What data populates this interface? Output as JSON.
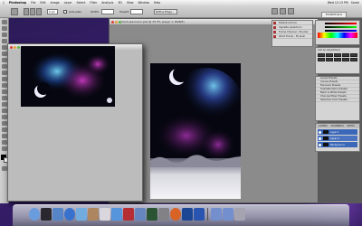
{
  "menubar": {
    "app": "Photoshop",
    "items": [
      "File",
      "Edit",
      "Image",
      "Layer",
      "Select",
      "Filter",
      "Analysis",
      "3D",
      "View",
      "Window",
      "Help"
    ],
    "right": [
      "Wed 12:13 PM",
      "Sarah"
    ]
  },
  "options": {
    "field_value": "0 px",
    "label_antialias": "Anti-alias",
    "label_width": "Width:",
    "label_height": "Height:",
    "refine": "Refine Edge...",
    "workspace": "ESSENTIALS"
  },
  "doc_main": {
    "title": "cloud-sea-moon.psd @ 33.3% (Layer 1, RGB/8)"
  },
  "doc_source": {
    "title": "space-nebula.jpg @ 33% (RGB/8)"
  },
  "nav_panel": {
    "rows": [
      "Default Actions",
      "Vignette (selection)",
      "Frame Channel - 50 pixel",
      "Wood Frame - 50 pixel"
    ]
  },
  "adjust_panel": {
    "title": "Add an adjustment"
  },
  "list_panel": {
    "rows": [
      "Levels Presets",
      "Curves Presets",
      "Exposure Presets",
      "Hue/Saturation Presets",
      "Black & White Presets",
      "Channel Mixer Presets",
      "Selective Color Presets"
    ]
  },
  "layers_panel": {
    "tabs": [
      "LAYERS",
      "CHANNELS",
      "PATHS"
    ],
    "rows": [
      "Layer 1",
      "Layer 2",
      "Background"
    ]
  },
  "dock": {
    "icons": [
      "finder-icon",
      "dashboard-icon",
      "mail-icon",
      "safari-icon",
      "ichat-icon",
      "address-book-icon",
      "calendar-icon",
      "itunes-icon",
      "photobooth-icon",
      "iphoto-icon",
      "time-machine-icon",
      "system-preferences-icon",
      "firefox-icon",
      "photoshop-icon",
      "word-icon",
      "downloads-icon",
      "documents-icon",
      "trash-icon"
    ],
    "colors": [
      "#6fa8e8",
      "#2a2a2a",
      "#5a8fd0",
      "#3a7ad8",
      "#78b8e8",
      "#b89060",
      "#e8e8e8",
      "#5aa0e8",
      "#c03030",
      "#6a90c8",
      "#2a5a30",
      "#8a8a8a",
      "#e86a20",
      "#1a4a9a",
      "#2a5ab8",
      "#7a9ad8",
      "#7a9ad8",
      "#b0b0b8"
    ]
  },
  "colors": {
    "accent": "#3b67b8"
  }
}
